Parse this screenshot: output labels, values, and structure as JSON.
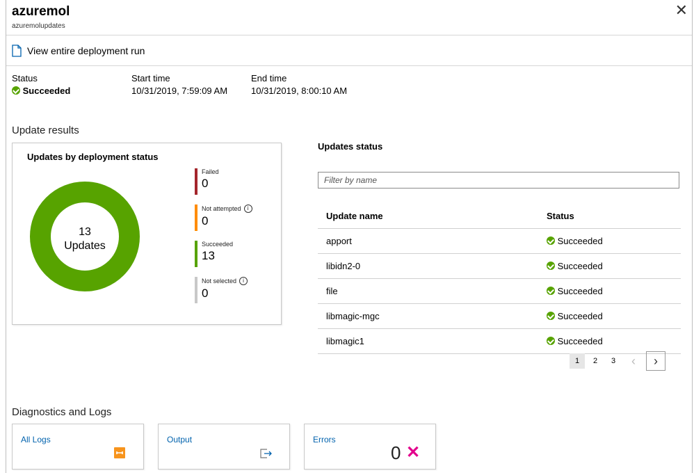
{
  "header": {
    "title": "azuremol",
    "subtitle": "azuremolupdates",
    "close_icon": "close-icon"
  },
  "toolbar": {
    "view_run_label": "View entire deployment run",
    "view_run_icon": "document-icon"
  },
  "summary": {
    "status_label": "Status",
    "status_value": "Succeeded",
    "start_label": "Start time",
    "start_value": "10/31/2019, 7:59:09 AM",
    "end_label": "End time",
    "end_value": "10/31/2019, 8:00:10 AM"
  },
  "results": {
    "section_title": "Update results",
    "chart_title": "Updates by deployment status",
    "center_count": "13",
    "center_label": "Updates",
    "legend": [
      {
        "label": "Failed",
        "value": "0",
        "color": "#a4262c",
        "info": false
      },
      {
        "label": "Not attempted",
        "value": "0",
        "color": "#ff8c00",
        "info": true
      },
      {
        "label": "Succeeded",
        "value": "13",
        "color": "#57a300",
        "info": false
      },
      {
        "label": "Not selected",
        "value": "0",
        "color": "#c8c8c8",
        "info": true
      }
    ]
  },
  "chart_data": {
    "type": "pie",
    "categories": [
      "Failed",
      "Not attempted",
      "Succeeded",
      "Not selected"
    ],
    "values": [
      0,
      0,
      13,
      0
    ],
    "colors": [
      "#a4262c",
      "#ff8c00",
      "#57a300",
      "#c8c8c8"
    ],
    "title": "Updates by deployment status"
  },
  "updates": {
    "title": "Updates status",
    "filter_placeholder": "Filter by name",
    "col_name": "Update name",
    "col_status": "Status",
    "rows": [
      {
        "name": "apport",
        "status": "Succeeded"
      },
      {
        "name": "libidn2-0",
        "status": "Succeeded"
      },
      {
        "name": "file",
        "status": "Succeeded"
      },
      {
        "name": "libmagic-mgc",
        "status": "Succeeded"
      },
      {
        "name": "libmagic1",
        "status": "Succeeded"
      }
    ],
    "pages": [
      "1",
      "2",
      "3"
    ],
    "current_page": "1"
  },
  "diagnostics": {
    "title": "Diagnostics and Logs",
    "all_logs_label": "All Logs",
    "output_label": "Output",
    "errors_label": "Errors",
    "errors_count": "0"
  },
  "colors": {
    "success": "#57a300",
    "link": "#0062ad",
    "error": "#e3008c",
    "log_icon": "#f7941d"
  }
}
